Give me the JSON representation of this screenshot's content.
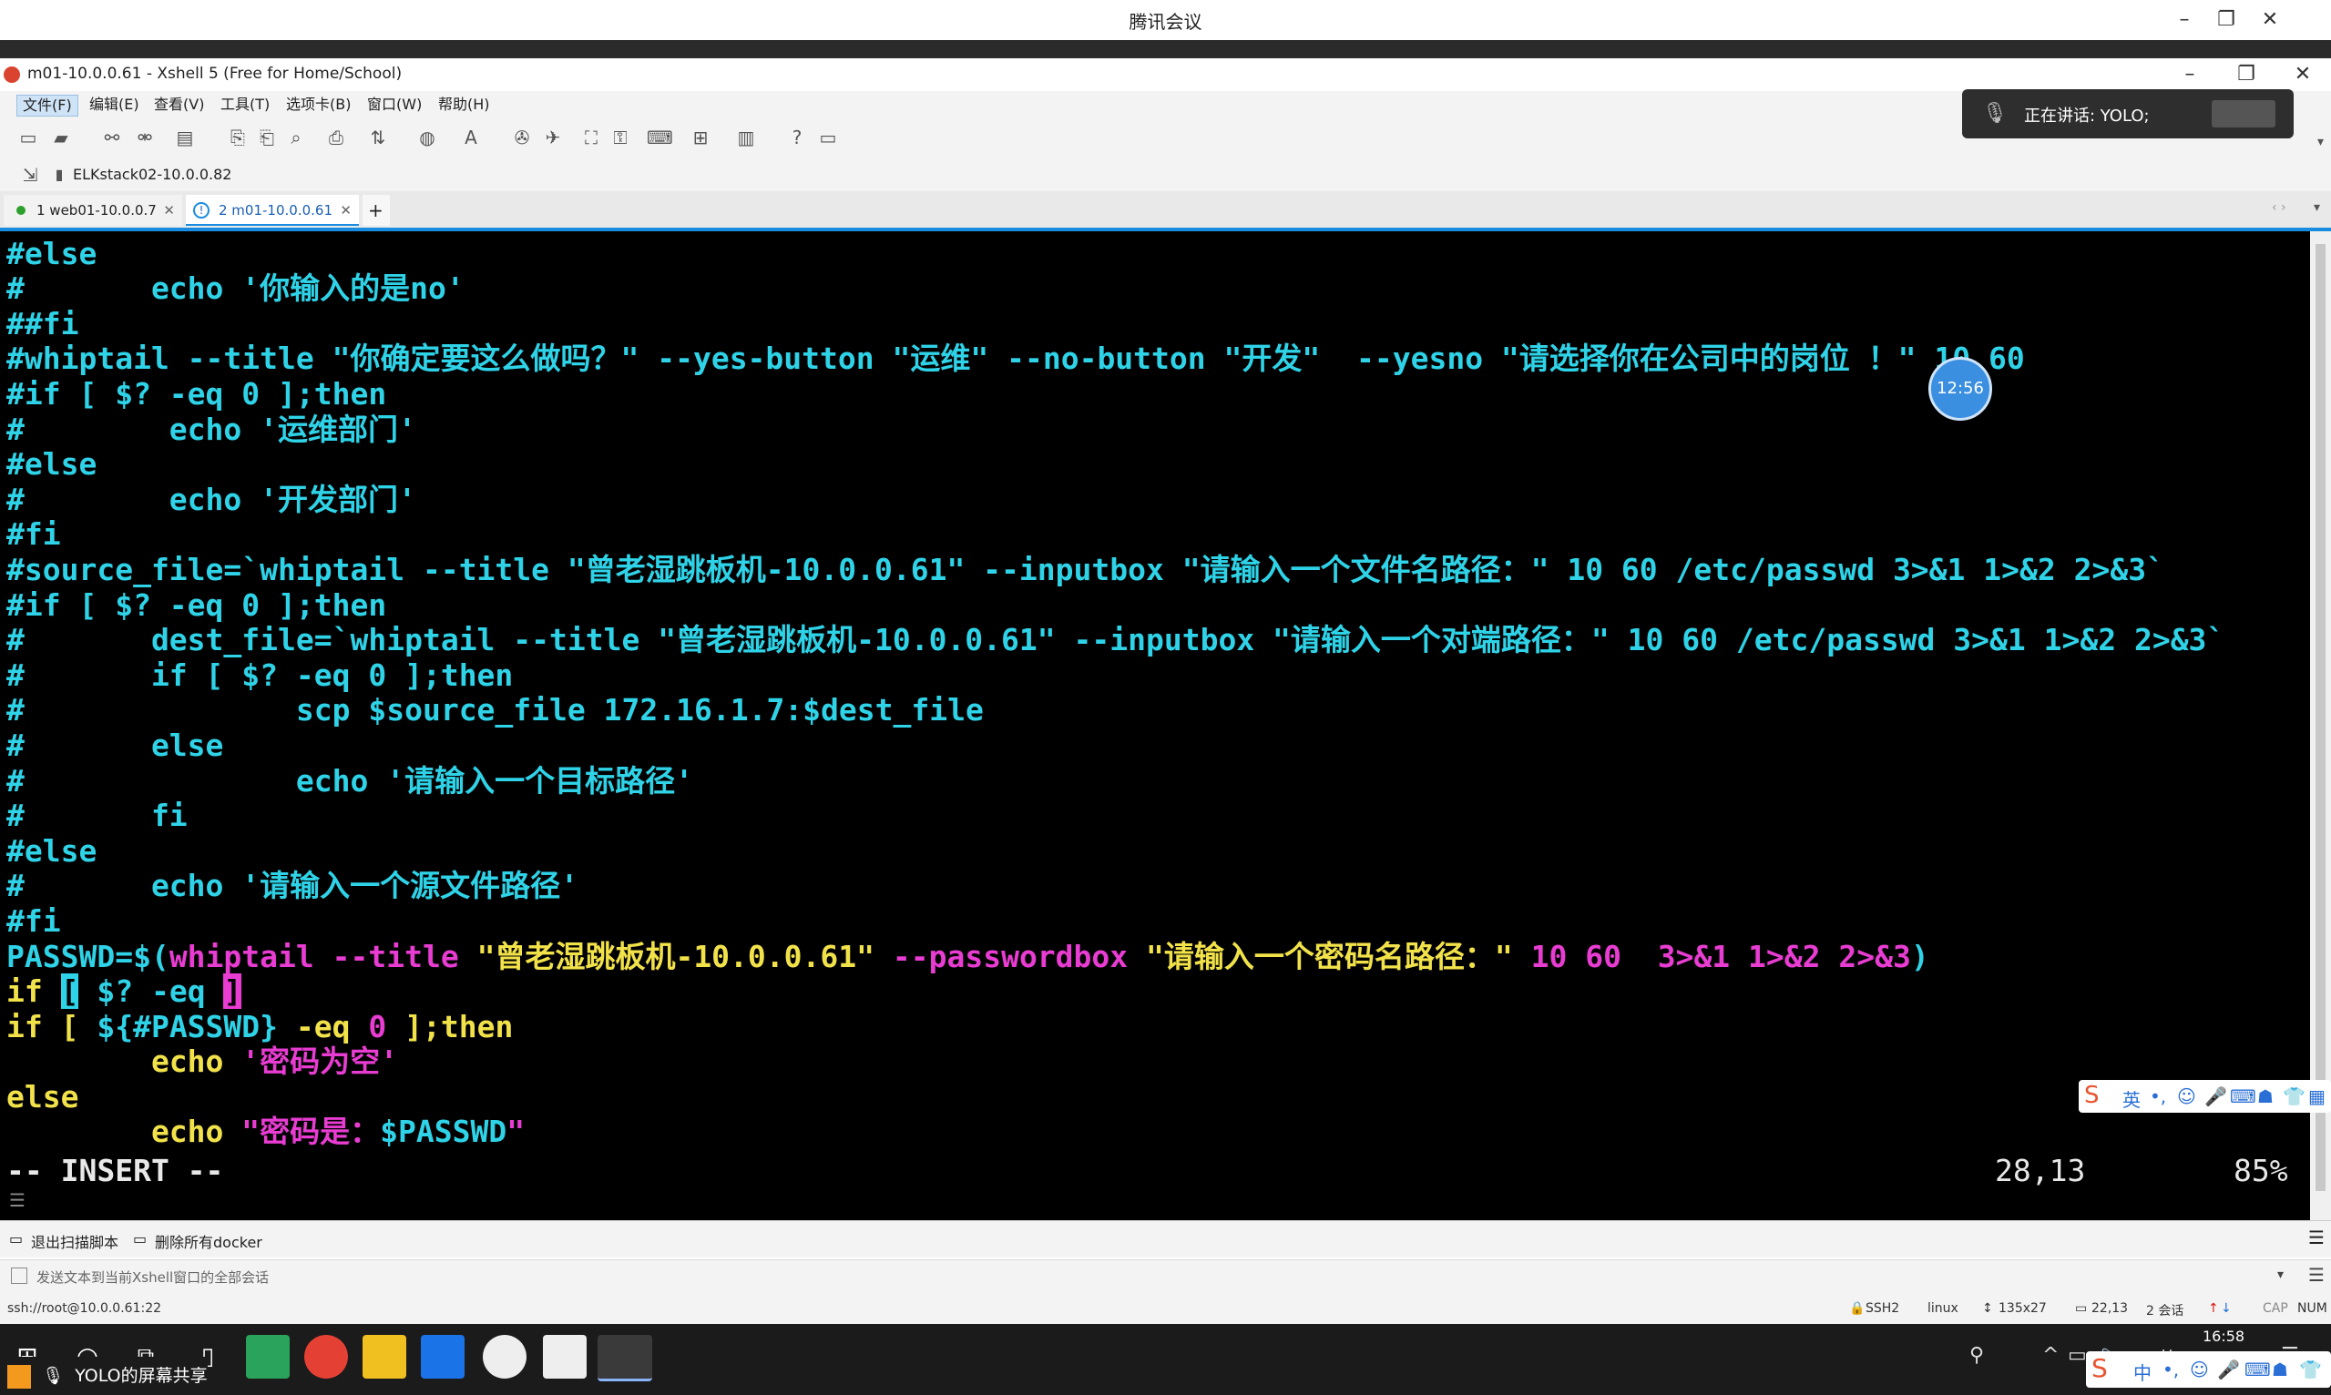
{
  "meeting": {
    "title": "腾讯会议",
    "speaking": "正在讲话: YOLO;",
    "timer": "12:56",
    "share_label": "YOLO的屏幕共享"
  },
  "window": {
    "title": "m01-10.0.0.61 - Xshell 5 (Free for Home/School)"
  },
  "menu": [
    "文件(F)",
    "编辑(E)",
    "查看(V)",
    "工具(T)",
    "选项卡(B)",
    "窗口(W)",
    "帮助(H)"
  ],
  "address_bar": {
    "session": "ELKstack02-10.0.0.82"
  },
  "tabs": [
    {
      "label": "1 web01-10.0.0.7",
      "active": false
    },
    {
      "label": "2 m01-10.0.0.61",
      "active": true
    }
  ],
  "terminal": {
    "lines": [
      "#else",
      "#       echo '你输入的是no'",
      "##fi",
      "#whiptail --title \"你确定要这么做吗？\" --yes-button \"运维\" --no-button \"开发\"  --yesno \"请选择你在公司中的岗位 ！\" 10 60",
      "#if [ $? -eq 0 ];then",
      "#        echo '运维部门'",
      "#else",
      "#        echo '开发部门'",
      "#fi",
      "#source_file=`whiptail --title \"曾老湿跳板机-10.0.0.61\" --inputbox \"请输入一个文件名路径：\" 10 60 /etc/passwd 3>&1 1>&2 2>&3`",
      "#if [ $? -eq 0 ];then",
      "#       dest_file=`whiptail --title \"曾老湿跳板机-10.0.0.61\" --inputbox \"请输入一个对端路径：\" 10 60 /etc/passwd 3>&1 1>&2 2>&3`",
      "#       if [ $? -eq 0 ];then",
      "#               scp $source_file 172.16.1.7:$dest_file",
      "#       else",
      "#               echo '请输入一个目标路径'",
      "#       fi",
      "#else",
      "#       echo '请输入一个源文件路径'",
      "#fi"
    ],
    "passwd_line": {
      "a": "PASSWD=$(",
      "b": "whiptail --title ",
      "c": "\"曾老湿跳板机-10.0.0.61\"",
      "d": " --passwordbox ",
      "e": "\"请输入一个密码名路径：\"",
      "f": " 10 60  3>&1 1>&2 2>&3",
      "g": ")"
    },
    "if1": {
      "a": "if ",
      "b": "[",
      "c": " $? -eq ",
      "d": "]"
    },
    "if2": {
      "a": "if [ ",
      "b": "${#PASSWD}",
      "c": " -eq ",
      "d": "0",
      "e": " ];then"
    },
    "echo1": {
      "a": "        echo ",
      "b": "'密码为空'"
    },
    "else": "else",
    "echo2": {
      "a": "        echo ",
      "b": "\"密码是：",
      "c": "$PASSWD",
      "d": "\""
    },
    "mode": "-- INSERT --",
    "position": "28,13",
    "percent": "85%"
  },
  "quick_commands": [
    "退出扫描脚本",
    "删除所有docker"
  ],
  "send_bar": {
    "placeholder": "发送文本到当前Xshell窗口的全部会话"
  },
  "status": {
    "connection": "ssh://root@10.0.0.61:22",
    "protocol": "SSH2",
    "term": "linux",
    "size": "135x27",
    "cursor": "22,13",
    "sessions": "2 会话",
    "cap": "CAP",
    "num": "NUM"
  },
  "taskbar": {
    "time": "16:58",
    "ime": "中",
    "lang": "英"
  },
  "colors": {
    "cyan": "#2fd3e8",
    "yellow": "#f2e24a",
    "magenta": "#e83cd2",
    "tab_accent": "#1a8cdf"
  }
}
